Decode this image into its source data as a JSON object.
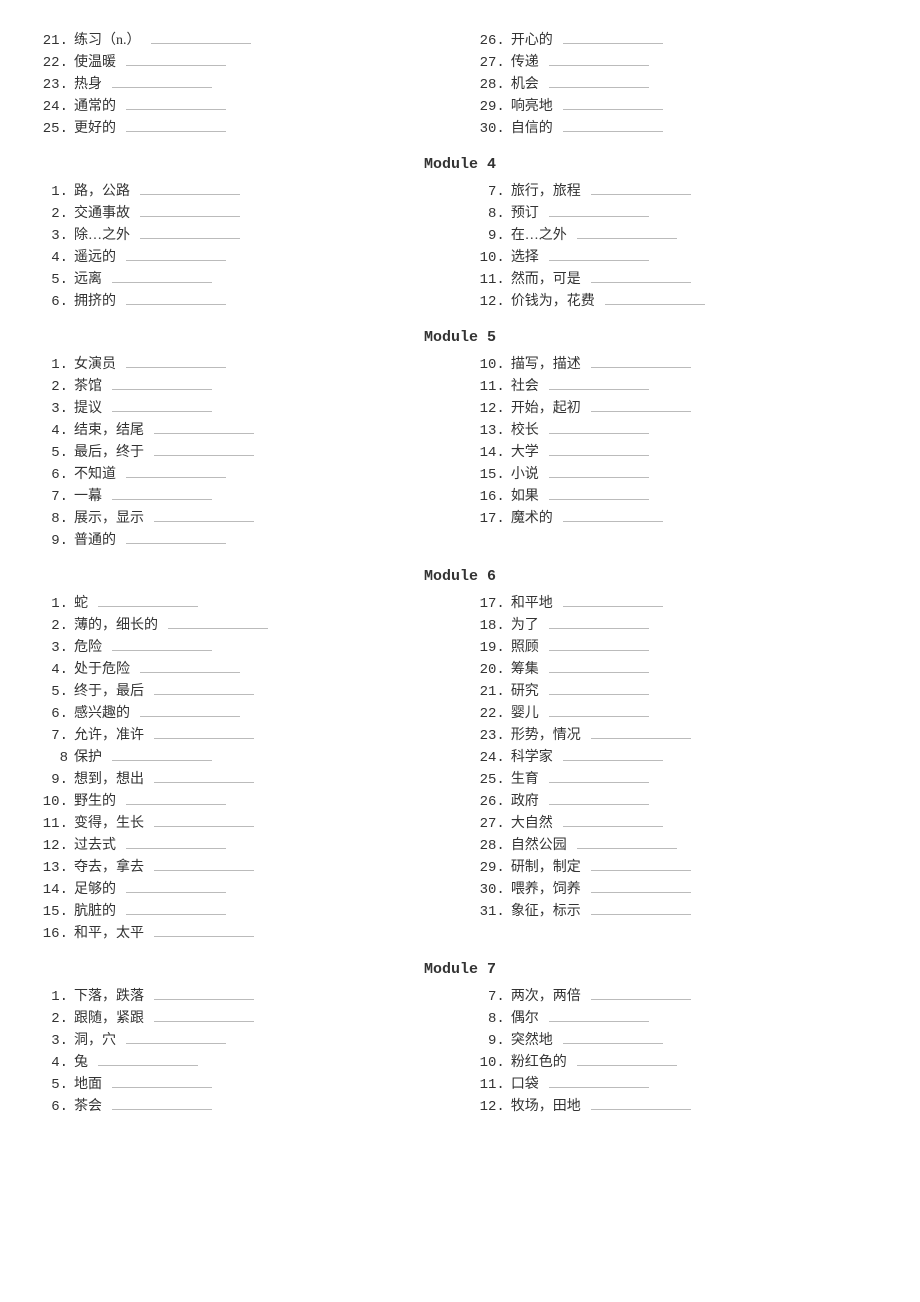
{
  "top": {
    "left": [
      {
        "num": "21.",
        "word": "练习（n.）"
      },
      {
        "num": "22.",
        "word": "使温暖"
      },
      {
        "num": "23.",
        "word": "热身"
      },
      {
        "num": "24.",
        "word": "通常的"
      },
      {
        "num": "25.",
        "word": "更好的"
      }
    ],
    "right": [
      {
        "num": "26.",
        "word": "开心的"
      },
      {
        "num": "27.",
        "word": "传递"
      },
      {
        "num": "28.",
        "word": "机会"
      },
      {
        "num": "29.",
        "word": "响亮地"
      },
      {
        "num": "30.",
        "word": "自信的"
      }
    ]
  },
  "modules": [
    {
      "title": "Module  4",
      "left": [
        {
          "num": "1.",
          "word": "路，公路"
        },
        {
          "num": "2.",
          "word": "交通事故"
        },
        {
          "num": "3.",
          "word": "除…之外"
        },
        {
          "num": "4.",
          "word": "遥远的"
        },
        {
          "num": "5.",
          "word": "远离"
        },
        {
          "num": "6.",
          "word": "拥挤的"
        }
      ],
      "right": [
        {
          "num": "7.",
          "word": "旅行，旅程"
        },
        {
          "num": "8.",
          "word": "预订"
        },
        {
          "num": "9.",
          "word": "在…之外"
        },
        {
          "num": "10.",
          "word": "选择"
        },
        {
          "num": "11.",
          "word": "然而，可是"
        },
        {
          "num": "12.",
          "word": "价钱为，花费"
        }
      ]
    },
    {
      "title": "Module  5",
      "left": [
        {
          "num": "1.",
          "word": "女演员"
        },
        {
          "num": "2.",
          "word": "茶馆"
        },
        {
          "num": "3.",
          "word": "提议"
        },
        {
          "num": "4.",
          "word": "结束，结尾"
        },
        {
          "num": "5.",
          "word": "最后，终于"
        },
        {
          "num": "6.",
          "word": "不知道"
        },
        {
          "num": "7.",
          "word": "一幕"
        },
        {
          "num": "8.",
          "word": "展示，显示"
        },
        {
          "num": "9.",
          "word": "普通的"
        }
      ],
      "right": [
        {
          "num": "10.",
          "word": "描写，描述"
        },
        {
          "num": "11.",
          "word": "社会"
        },
        {
          "num": "12.",
          "word": "开始，起初"
        },
        {
          "num": "13.",
          "word": "校长"
        },
        {
          "num": "14.",
          "word": "大学"
        },
        {
          "num": "15.",
          "word": "小说"
        },
        {
          "num": "16.",
          "word": "如果"
        },
        {
          "num": "17.",
          "word": "魔术的"
        }
      ]
    },
    {
      "title": "Module  6",
      "left": [
        {
          "num": "1.",
          "word": "蛇"
        },
        {
          "num": "2.",
          "word": "薄的，细长的"
        },
        {
          "num": "3.",
          "word": "危险"
        },
        {
          "num": "4.",
          "word": "处于危险"
        },
        {
          "num": "5.",
          "word": "终于，最后"
        },
        {
          "num": "6.",
          "word": "感兴趣的"
        },
        {
          "num": "7.",
          "word": "允许，准许"
        },
        {
          "num": "8",
          "word": "保护"
        },
        {
          "num": "9.",
          "word": "想到，想出"
        },
        {
          "num": "10.",
          "word": "野生的"
        },
        {
          "num": "11.",
          "word": "变得，生长"
        },
        {
          "num": "12.",
          "word": "过去式"
        },
        {
          "num": "13.",
          "word": "夺去，拿去"
        },
        {
          "num": "14.",
          "word": "足够的"
        },
        {
          "num": "15.",
          "word": "肮脏的"
        },
        {
          "num": "16.",
          "word": "和平，太平"
        }
      ],
      "right": [
        {
          "num": "17.",
          "word": "和平地"
        },
        {
          "num": "18.",
          "word": "为了"
        },
        {
          "num": "19.",
          "word": "照顾"
        },
        {
          "num": "20.",
          "word": "筹集"
        },
        {
          "num": "21.",
          "word": "研究"
        },
        {
          "num": "22.",
          "word": "婴儿"
        },
        {
          "num": "23.",
          "word": "形势，情况"
        },
        {
          "num": "24.",
          "word": "科学家"
        },
        {
          "num": "25.",
          "word": "生育"
        },
        {
          "num": "26.",
          "word": "政府"
        },
        {
          "num": "27.",
          "word": "大自然"
        },
        {
          "num": "28.",
          "word": "自然公园"
        },
        {
          "num": "29.",
          "word": "研制，制定"
        },
        {
          "num": "30.",
          "word": "喂养，饲养"
        },
        {
          "num": "31.",
          "word": "象征，标示"
        }
      ]
    },
    {
      "title": "Module  7",
      "left": [
        {
          "num": "1.",
          "word": "下落，跌落"
        },
        {
          "num": "2.",
          "word": "跟随，紧跟"
        },
        {
          "num": "3.",
          "word": "洞，穴"
        },
        {
          "num": "4.",
          "word": "兔"
        },
        {
          "num": "5.",
          "word": "地面"
        },
        {
          "num": "6.",
          "word": "茶会"
        }
      ],
      "right": [
        {
          "num": "7.",
          "word": "两次，两倍"
        },
        {
          "num": "8.",
          "word": "偶尔"
        },
        {
          "num": "9.",
          "word": "突然地"
        },
        {
          "num": "10.",
          "word": "粉红色的"
        },
        {
          "num": "11.",
          "word": "口袋"
        },
        {
          "num": "12.",
          "word": "牧场，田地"
        }
      ]
    }
  ]
}
